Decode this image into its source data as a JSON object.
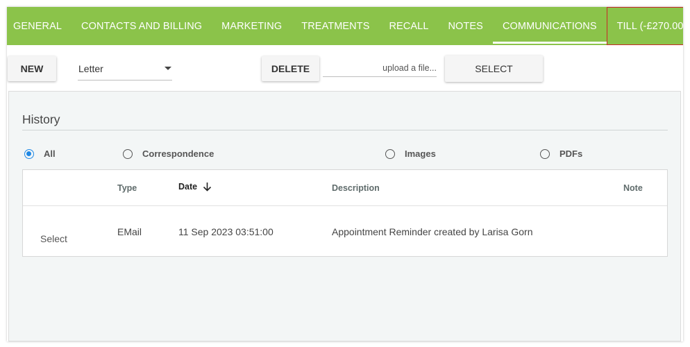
{
  "tabs": [
    {
      "label": "GENERAL"
    },
    {
      "label": "CONTACTS AND BILLING"
    },
    {
      "label": "MARKETING"
    },
    {
      "label": "TREATMENTS"
    },
    {
      "label": "RECALL"
    },
    {
      "label": "NOTES"
    },
    {
      "label": "COMMUNICATIONS"
    },
    {
      "label": "TILL (-£270.00"
    }
  ],
  "active_tab": "COMMUNICATIONS",
  "toolbar": {
    "new_label": "NEW",
    "template_value": "Letter",
    "delete_label": "DELETE",
    "upload_placeholder": "upload a file...",
    "select_label": "SELECT"
  },
  "history": {
    "title": "History",
    "filters": [
      {
        "label": "All",
        "checked": true
      },
      {
        "label": "Correspondence",
        "checked": false
      },
      {
        "label": "Images",
        "checked": false
      },
      {
        "label": "PDFs",
        "checked": false
      }
    ],
    "columns": {
      "type": "Type",
      "date": "Date",
      "description": "Description",
      "note": "Note"
    },
    "rows": [
      {
        "action": "Select",
        "type": "EMail",
        "date": "11 Sep 2023 03:51:00",
        "description": "Appointment Reminder created by Larisa Gorn",
        "note": ""
      }
    ]
  },
  "colors": {
    "tab_bar": "#8bc34a",
    "radio_selected": "#1e88e5",
    "till_border": "#c62828"
  }
}
